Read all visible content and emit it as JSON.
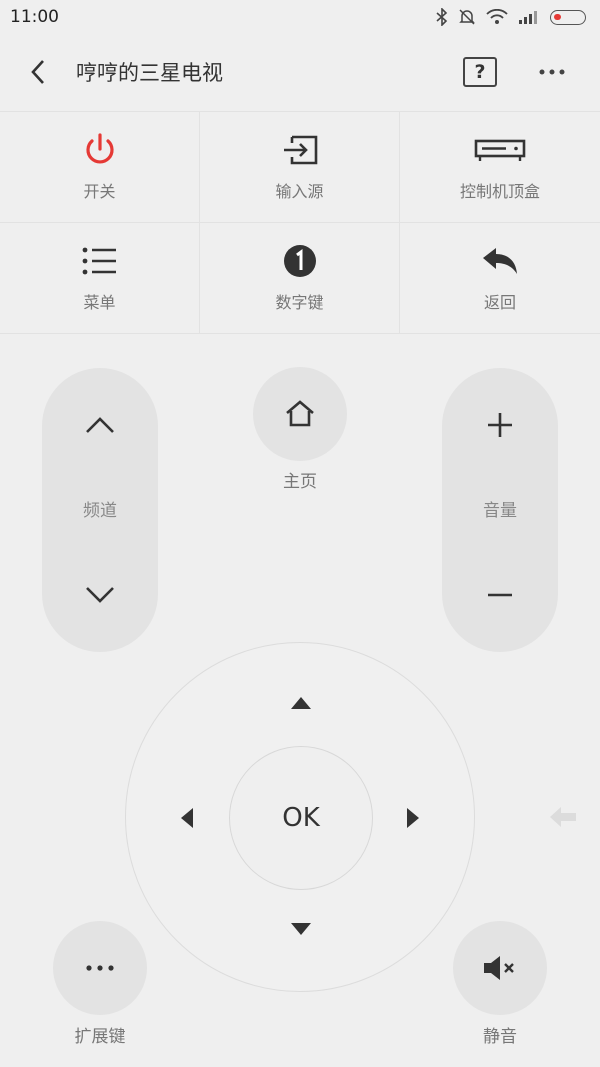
{
  "status": {
    "time": "11:00"
  },
  "appbar": {
    "title": "哼哼的三星电视",
    "help": "?"
  },
  "grid": [
    {
      "label": "开关",
      "icon": "power-icon",
      "color": "#e53935"
    },
    {
      "label": "输入源",
      "icon": "input-source-icon"
    },
    {
      "label": "控制机顶盒",
      "icon": "set-top-box-icon"
    },
    {
      "label": "菜单",
      "icon": "menu-list-icon"
    },
    {
      "label": "数字键",
      "icon": "number-one-icon"
    },
    {
      "label": "返回",
      "icon": "reply-back-icon"
    }
  ],
  "channel": {
    "label": "频道"
  },
  "home": {
    "label": "主页"
  },
  "volume": {
    "label": "音量"
  },
  "dpad": {
    "ok": "OK"
  },
  "extend": {
    "label": "扩展键"
  },
  "mute": {
    "label": "静音"
  }
}
